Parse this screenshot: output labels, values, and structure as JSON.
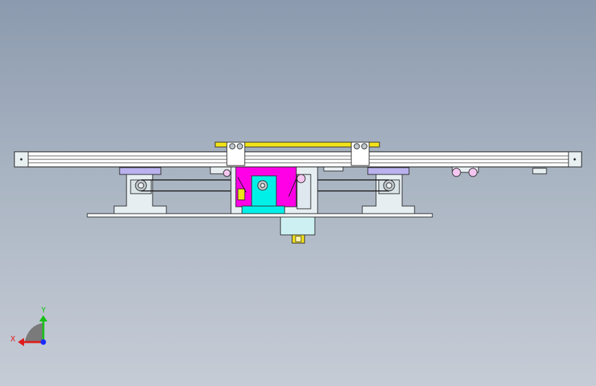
{
  "viewport": {
    "background_top": "#8b9aae",
    "background_bottom": "#c6ccd6",
    "view": "front"
  },
  "model": {
    "colors": {
      "rail": "#ffffff",
      "rail_edge": "#2a2a2a",
      "top_plate": "#f2e21a",
      "carriage": "#ff00e6",
      "motor_block": "#00f0e8",
      "bracket": "#e6eef2",
      "pad": "#b9b2ee",
      "pulley": "#f4c6f0",
      "plate": "#f4f6f8",
      "bearing": "#bfc7cc"
    }
  },
  "triad": {
    "x_label": "X",
    "y_label": "Y",
    "x_color": "#e01b1b",
    "y_color": "#18c018",
    "z_color": "#1a2cff",
    "plane_color": "#7a7a7a"
  }
}
